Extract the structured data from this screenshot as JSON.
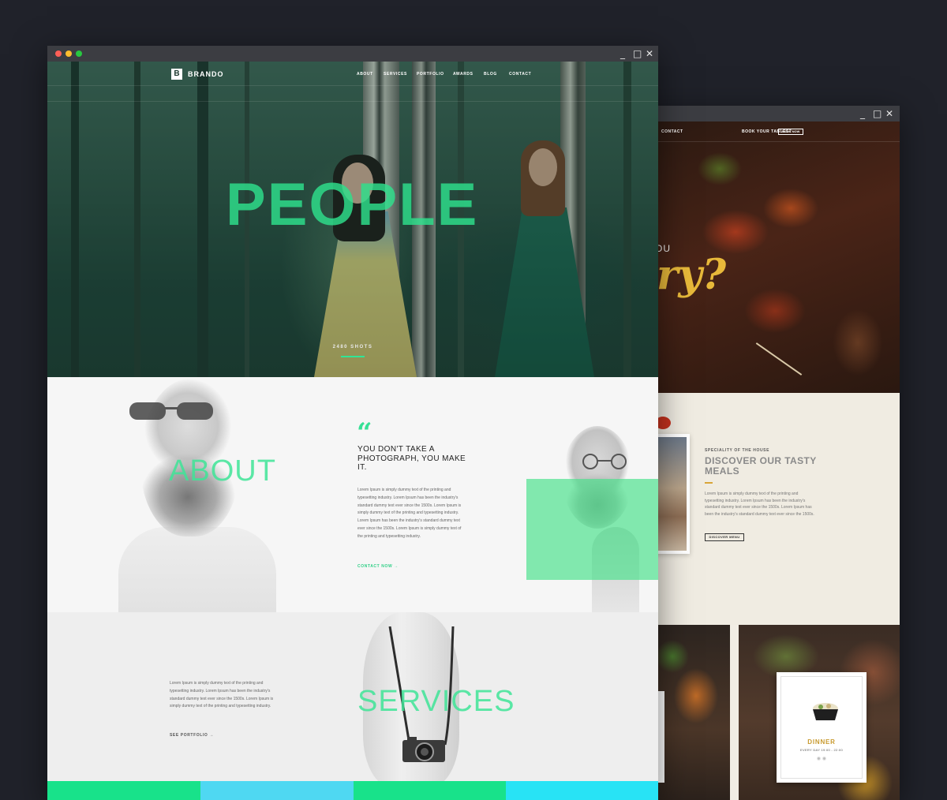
{
  "back_window": {
    "controls": {
      "minimize": "_",
      "maximize": "□",
      "close": "✕"
    },
    "nav": {
      "contact": "CONTACT",
      "book_prompt": "BOOK YOUR TABLES?",
      "book_button": "BOOK NOW"
    },
    "hero": {
      "partial_word": "OU",
      "script_text": "ry?"
    },
    "about": {
      "kicker": "SPECIALITY OF THE HOUSE",
      "heading": "DISCOVER OUR TASTY MEALS",
      "paragraph": "Lorem Ipsum is simply dummy text of the printing and typesetting industry. Lorem Ipsum has been the industry's standard dummy text ever since the 1500s. Lorem Ipsum has been the industry's standard dummy text ever since the 1500s.",
      "button": "DISCOVER MENU"
    },
    "menu_card": {
      "title": "DINNER",
      "time": "EVERY DAY 19:00 - 22:00",
      "dots": "◉ ◉"
    },
    "icons": [
      "bowl-icon"
    ],
    "colors": {
      "accent": "#c89a2e"
    }
  },
  "front_window": {
    "controls": {
      "minimize": "_",
      "maximize": "□",
      "close": "✕"
    },
    "brand": {
      "logo": "B",
      "name": "BRANDO"
    },
    "nav": [
      "ABOUT",
      "SERVICES",
      "PORTFOLIO",
      "AWARDS",
      "BLOG",
      "CONTACT"
    ],
    "hero": {
      "title": "PEOPLE",
      "count": "2480 SHOTS"
    },
    "about": {
      "title": "ABOUT",
      "quote_mark": "“",
      "quote": "YOU DON'T TAKE A PHOTOGRAPH, YOU MAKE IT.",
      "paragraph": "Lorem Ipsum is simply dummy text of the printing and typesetting industry. Lorem Ipsum has been the industry's standard dummy text ever since the 1500s. Lorem Ipsum is simply dummy text of the printing and typesetting industry. Lorem Ipsum has been the industry's standard dummy text ever since the 1500s. Lorem Ipsum is simply dummy text of the printing and typesetting industry.",
      "cta": "CONTACT NOW →"
    },
    "services": {
      "title": "SERVICES",
      "paragraph": "Lorem Ipsum is simply dummy text of the printing and typesetting industry. Lorem Ipsum has been the industry's standard dummy text ever since the 1500s. Lorem Ipsum is simply dummy text of the printing and typesetting industry.",
      "cta": "SEE PORTFOLIO →"
    },
    "strip_colors": [
      "#18e28a",
      "#4fd8f2",
      "#18e28a",
      "#28e3f5"
    ],
    "colors": {
      "accent": "#36e095",
      "window_dots": [
        "#ff5f57",
        "#ffbd2e",
        "#28c840"
      ]
    }
  }
}
